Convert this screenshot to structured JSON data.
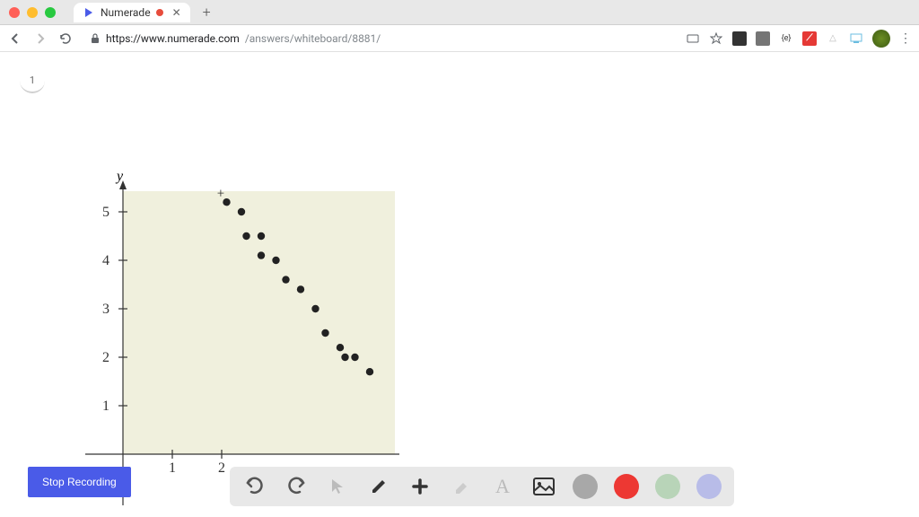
{
  "window": {
    "tab_title": "Numerade",
    "url_host": "https://www.numerade.com",
    "url_path": "/answers/whiteboard/8881/"
  },
  "page": {
    "corner_number": "1"
  },
  "chart_data": {
    "type": "scatter",
    "title": "",
    "xlabel": "",
    "ylabel": "y",
    "xlim": [
      0,
      5.5
    ],
    "ylim": [
      0,
      5.5
    ],
    "x_ticks": [
      1,
      2
    ],
    "y_ticks": [
      1,
      2,
      3,
      4,
      5
    ],
    "series": [
      {
        "name": "points",
        "x": [
          2.1,
          2.4,
          2.5,
          2.8,
          2.8,
          3.1,
          3.3,
          3.6,
          3.9,
          4.1,
          4.4,
          4.5,
          4.7,
          5.0
        ],
        "y": [
          5.2,
          5.0,
          4.5,
          4.5,
          4.1,
          4.0,
          3.6,
          3.4,
          3.0,
          2.5,
          2.2,
          2.0,
          2.0,
          1.7
        ]
      }
    ]
  },
  "controls": {
    "stop_recording": "Stop Recording"
  },
  "toolbar": {
    "undo": "undo",
    "redo": "redo",
    "pointer": "pointer",
    "pencil": "pencil",
    "plus": "plus",
    "eraser": "eraser",
    "text": "text",
    "image": "image"
  },
  "colors": {
    "grey": "#a8a8a8",
    "red": "#ed3833",
    "green": "#b8d4b8",
    "blue": "#b8bce8"
  }
}
